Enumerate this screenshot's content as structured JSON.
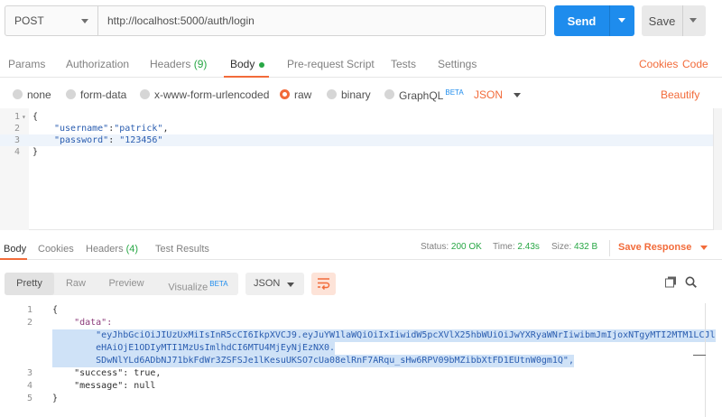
{
  "request": {
    "method": "POST",
    "url": "http://localhost:5000/auth/login",
    "send_label": "Send",
    "save_label": "Save"
  },
  "request_tabs": {
    "params": "Params",
    "authorization": "Authorization",
    "headers": "Headers",
    "headers_count": "(9)",
    "body": "Body",
    "pre_request": "Pre-request Script",
    "tests": "Tests",
    "settings": "Settings",
    "cookies": "Cookies",
    "code": "Code"
  },
  "body_options": {
    "none": "none",
    "form_data": "form-data",
    "urlencoded": "x-www-form-urlencoded",
    "raw": "raw",
    "binary": "binary",
    "graphql": "GraphQL",
    "beta": "BETA",
    "format": "JSON",
    "beautify": "Beautify",
    "selected": "raw"
  },
  "editor": {
    "lines": [
      {
        "num": "1",
        "text": "{"
      },
      {
        "num": "2",
        "key": "\"username\"",
        "sep": ":",
        "value": "\"patrick\"",
        "tail": ","
      },
      {
        "num": "3",
        "key": "\"password\"",
        "sep": ": ",
        "value": "\"123456\"",
        "tail": ""
      },
      {
        "num": "4",
        "text": "}"
      }
    ]
  },
  "response_tabs": {
    "body": "Body",
    "cookies": "Cookies",
    "headers": "Headers",
    "headers_count": "(4)",
    "test_results": "Test Results"
  },
  "response_status": {
    "status_label": "Status:",
    "status_value": "200 OK",
    "time_label": "Time:",
    "time_value": "2.43s",
    "size_label": "Size:",
    "size_value": "432 B",
    "save_response": "Save Response"
  },
  "response_view": {
    "pretty": "Pretty",
    "raw": "Raw",
    "preview": "Preview",
    "visualize": "Visualize",
    "beta": "BETA",
    "format": "JSON"
  },
  "response_body": {
    "lines": [
      {
        "num": "1",
        "text": "{"
      },
      {
        "num": "2",
        "text": "    \"data\":"
      },
      {
        "num": "",
        "text": "        \"eyJhbGciOiJIUzUxMiIsInR5cCI6IkpXVCJ9.eyJuYW1laWQiOiIxIiwidW5pcXVlX25hbWUiOiJwYXRyaWNrIiwibmJmIjoxNTgyMTI2MTM1LCJl"
      },
      {
        "num": "",
        "text": "        eHAiOjE1ODIyMTI1MzUsImlhdCI6MTU4MjEyNjEzNX0."
      },
      {
        "num": "",
        "text": "        SDwNlYLd6ADbNJ71bkFdWr3ZSFSJe1lKesuUKSO7cUa08elRnF7ARqu_sHw6RPV09bMZibbXtFD1EUtnW0gm1Q\","
      },
      {
        "num": "3",
        "text": "    \"success\": true,"
      },
      {
        "num": "4",
        "text": "    \"message\": null"
      },
      {
        "num": "5",
        "text": "}"
      }
    ]
  }
}
